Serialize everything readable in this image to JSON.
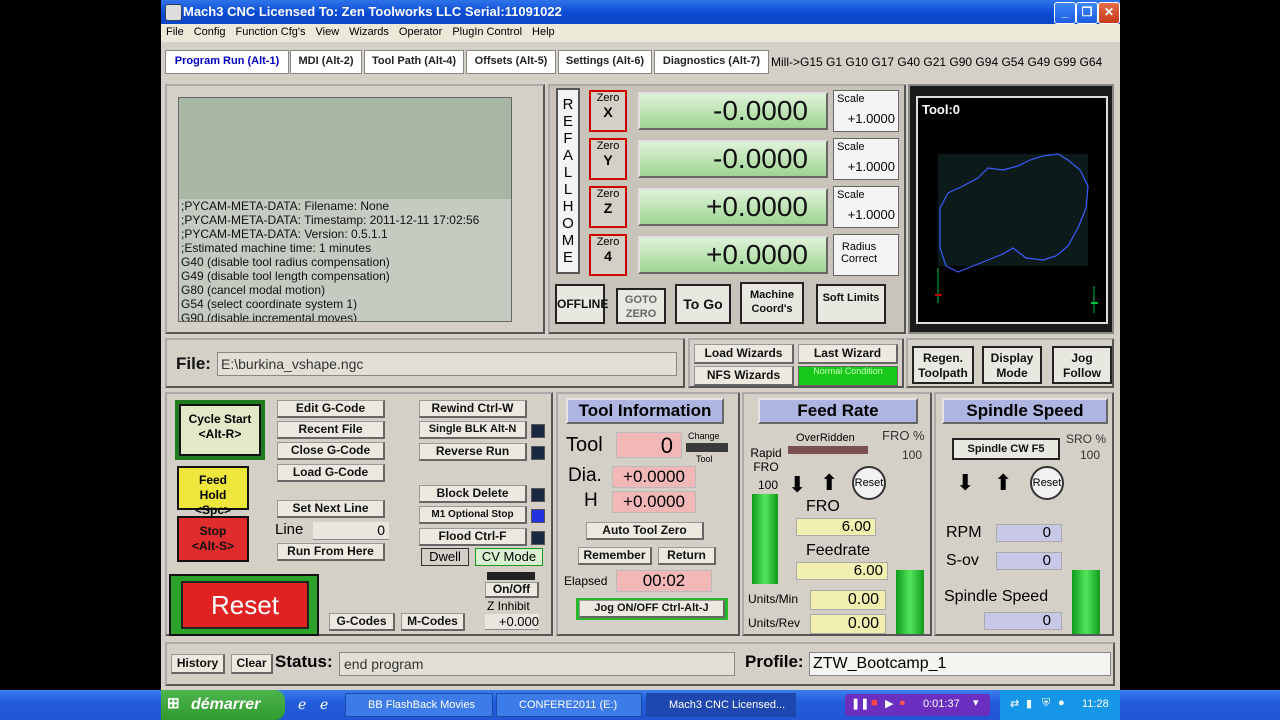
{
  "window": {
    "title": "Mach3 CNC  Licensed To: Zen Toolworks LLC Serial:11091022"
  },
  "menu": [
    "File",
    "Config",
    "Function Cfg's",
    "View",
    "Wizards",
    "Operator",
    "PlugIn Control",
    "Help"
  ],
  "tabs": [
    "Program Run (Alt-1)",
    "MDI (Alt-2)",
    "Tool Path (Alt-4)",
    "Offsets (Alt-5)",
    "Settings (Alt-6)",
    "Diagnostics (Alt-7)"
  ],
  "modal_codes": "Mill->G15  G1 G10 G17 G40 G21 G90 G94 G54 G49 G99 G64",
  "gcode_lines": [
    ";PYCAM-META-DATA: Filename: None",
    ";PYCAM-META-DATA: Timestamp: 2011-12-11 17:02:56",
    ";PYCAM-META-DATA: Version: 0.5.1.1",
    ";Estimated machine time: 1 minutes",
    "G40 (disable tool radius compensation)",
    "G49 (disable tool length compensation)",
    "G80 (cancel modal motion)",
    "G54 (select coordinate system 1)",
    "G90 (disable incremental moves)"
  ],
  "ref_all_home": [
    "R",
    "E",
    "F",
    "A",
    "L",
    "L",
    "H",
    "O",
    "M",
    "E"
  ],
  "axes": [
    {
      "zero_label": "Zero",
      "axis": "X",
      "value": "-0.0000",
      "scale_label": "Scale",
      "scale": "+1.0000"
    },
    {
      "zero_label": "Zero",
      "axis": "Y",
      "value": "-0.0000",
      "scale_label": "Scale",
      "scale": "+1.0000"
    },
    {
      "zero_label": "Zero",
      "axis": "Z",
      "value": "+0.0000",
      "scale_label": "Scale",
      "scale": "+1.0000"
    },
    {
      "zero_label": "Zero",
      "axis": "4",
      "value": "+0.0000",
      "scale_label": "Radius Correct",
      "scale": ""
    }
  ],
  "dro_buttons": {
    "offline": "OFFLINE",
    "goto_zero": "GOTO ZERO",
    "to_go": "To Go",
    "machine_coords": "Machine Coord's",
    "soft_limits": "Soft Limits"
  },
  "toolpath": {
    "tool_label": "Tool:0"
  },
  "file": {
    "label": "File:",
    "path": "E:\\burkina_vshape.ngc"
  },
  "wizards": {
    "load": "Load Wizards",
    "last": "Last Wizard",
    "nfs": "NFS Wizards",
    "normal": "Normal Condition"
  },
  "view_buttons": {
    "regen": "Regen. Toolpath",
    "display": "Display Mode",
    "jog": "Jog Follow"
  },
  "program": {
    "cycle_start": "Cycle Start <Alt-R>",
    "feed_hold": "Feed Hold <Spc>",
    "stop": "Stop <Alt-S>",
    "edit": "Edit G-Code",
    "recent": "Recent File",
    "close": "Close G-Code",
    "load": "Load G-Code",
    "set_next": "Set Next Line",
    "line_label": "Line",
    "line_value": "0",
    "run_from": "Run From Here",
    "rewind": "Rewind Ctrl-W",
    "single_blk": "Single BLK Alt-N",
    "reverse": "Reverse Run",
    "block_delete": "Block Delete",
    "m1_stop": "M1 Optional Stop",
    "flood": "Flood Ctrl-F",
    "dwell": "Dwell",
    "cv_mode": "CV Mode",
    "reset": "Reset",
    "gcodes": "G-Codes",
    "mcodes": "M-Codes",
    "onoff": "On/Off",
    "z_inhibit": "Z Inhibit",
    "z_value": "+0.000"
  },
  "tool_info": {
    "title": "Tool Information",
    "tool_label": "Tool",
    "tool": "0",
    "change": "Change",
    "tool_small": "Tool",
    "dia_label": "Dia.",
    "dia": "+0.0000",
    "h_label": "H",
    "h": "+0.0000",
    "auto_zero": "Auto Tool Zero",
    "remember": "Remember",
    "return": "Return",
    "elapsed_label": "Elapsed",
    "elapsed": "00:02",
    "jog": "Jog ON/OFF Ctrl-Alt-J"
  },
  "feed": {
    "title": "Feed Rate",
    "overridden": "OverRidden",
    "fro_pct_label": "FRO %",
    "fro_pct": "100",
    "rapid_label": "Rapid FRO",
    "rapid": "100",
    "reset": "Reset",
    "fro_label": "FRO",
    "fro": "6.00",
    "feedrate_label": "Feedrate",
    "feedrate": "6.00",
    "units_min_label": "Units/Min",
    "units_min": "0.00",
    "units_rev_label": "Units/Rev",
    "units_rev": "0.00"
  },
  "spindle": {
    "title": "Spindle Speed",
    "cw": "Spindle CW F5",
    "sro_label": "SRO %",
    "sro": "100",
    "reset": "Reset",
    "rpm_label": "RPM",
    "rpm": "0",
    "sov_label": "S-ov",
    "sov": "0",
    "speed_label": "Spindle Speed",
    "speed": "0"
  },
  "statusbar": {
    "history": "History",
    "clear": "Clear",
    "status_label": "Status:",
    "status": "end program",
    "profile_label": "Profile:",
    "profile": "ZTW_Bootcamp_1"
  },
  "taskbar": {
    "start": "démarrer",
    "tasks": [
      "BB FlashBack Movies",
      "CONFERE2011 (E:)",
      "Mach3 CNC  Licensed..."
    ],
    "media_time": "0:01:37",
    "clock": "11:28"
  }
}
